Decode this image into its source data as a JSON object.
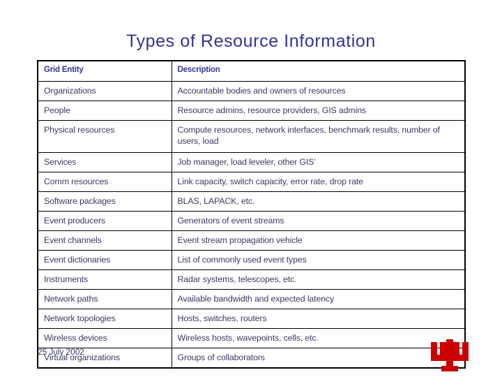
{
  "slide": {
    "title": "Types of Resource Information",
    "footer_date": "25 July 2002",
    "logo_name": "indiana-university-trident-logo",
    "colors": {
      "title": "#333399",
      "header_text": "#333399",
      "body_text": "#3b3b63",
      "border": "#000000",
      "logo_red": "#cc0000",
      "background": "#ffffff"
    }
  },
  "table": {
    "headers": {
      "entity": "Grid Entity",
      "description": "Description"
    },
    "rows": [
      {
        "entity": "Organizations",
        "description": "Accountable bodies and owners of resources"
      },
      {
        "entity": "People",
        "description": "Resource admins, resource providers, GIS admins"
      },
      {
        "entity": "Physical resources",
        "description": "Compute resources, network interfaces, benchmark results, number of users, load"
      },
      {
        "entity": "Services",
        "description": "Job manager, load leveler, other GIS’"
      },
      {
        "entity": "Comm resources",
        "description": "Link capacity, switch capacity, error rate, drop rate"
      },
      {
        "entity": "Software packages",
        "description": "BLAS, LAPACK, etc."
      },
      {
        "entity": "Event producers",
        "description": "Generators of event streams"
      },
      {
        "entity": "Event channels",
        "description": "Event stream propagation vehicle"
      },
      {
        "entity": "Event dictionaries",
        "description": "List of commonly used event types"
      },
      {
        "entity": "Instruments",
        "description": "Radar systems, telescopes, etc."
      },
      {
        "entity": "Network paths",
        "description": "Available bandwidth and expected latency"
      },
      {
        "entity": "Network topologies",
        "description": "Hosts, switches, routers"
      },
      {
        "entity": "Wireless devices",
        "description": "Wireless hosts, wavepoints, cells, etc."
      },
      {
        "entity": "Virtual organizations",
        "description": "Groups of collaborators"
      }
    ]
  }
}
